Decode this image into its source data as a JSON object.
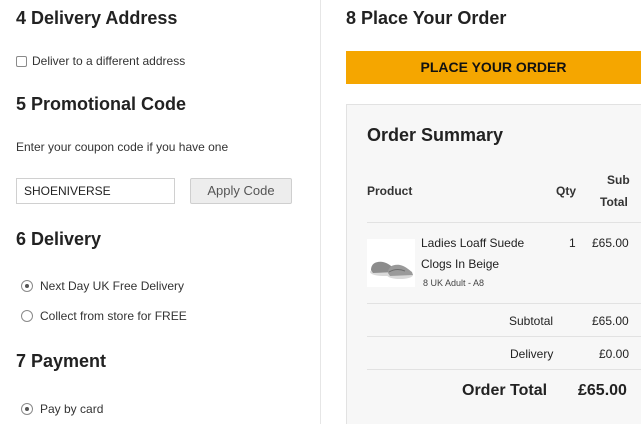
{
  "delivery_address": {
    "heading": "4 Delivery Address",
    "different_address_label": "Deliver to a different address"
  },
  "promo": {
    "heading": "5 Promotional Code",
    "prompt": "Enter your coupon code if you have one",
    "code_value": "SHOENIVERSE",
    "apply_label": "Apply Code"
  },
  "delivery": {
    "heading": "6 Delivery",
    "options": [
      {
        "label": "Next Day UK Free Delivery",
        "selected": true
      },
      {
        "label": "Collect from store for FREE",
        "selected": false
      }
    ]
  },
  "payment": {
    "heading": "7 Payment",
    "options": [
      {
        "label": "Pay by card",
        "selected": true
      }
    ]
  },
  "place_order": {
    "heading": "8 Place Your Order",
    "button_label": "PLACE YOUR ORDER",
    "button_color": "#f5a600"
  },
  "summary": {
    "title": "Order Summary",
    "columns": {
      "product": "Product",
      "qty": "Qty",
      "subtotal_line1": "Sub",
      "subtotal_line2": "Total"
    },
    "items": [
      {
        "name": "Ladies Loaff Suede Clogs In Beige",
        "variant": "8 UK Adult - A8",
        "qty": "1",
        "price": "£65.00",
        "image_icon": "clog-shoe-icon"
      }
    ],
    "subtotal_label": "Subtotal",
    "subtotal_value": "£65.00",
    "delivery_label": "Delivery",
    "delivery_value": "£0.00",
    "total_label": "Order Total",
    "total_value": "£65.00"
  }
}
